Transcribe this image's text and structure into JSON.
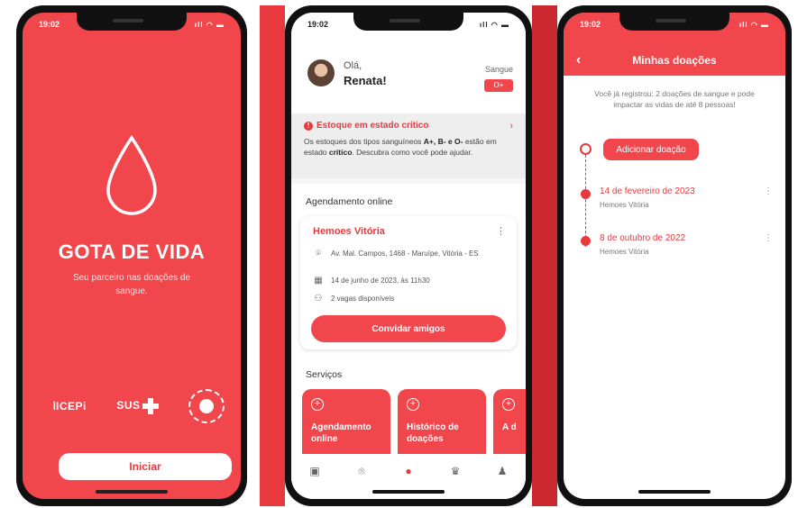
{
  "welcome": {
    "time": "19:02",
    "signal": "ıll ◠ ▬",
    "app_name": "GOTA DE VIDA",
    "tagline": "Seu parceiro nas doações de sangue.",
    "partner_icepi": "ICEPi",
    "partner_sus": "SUS",
    "start_label": "Iniciar"
  },
  "home": {
    "time": "19:02",
    "signal": "ıll ◠ ▬",
    "greeting": "Olá,",
    "user_name": "Renata!",
    "blood_label": "Sangue",
    "blood_type": "O+",
    "alert_title": "Estoque em estado crítico",
    "alert_text_1": "Os estoques dos tipos sanguíneos ",
    "alert_types": "A+, B- e O-",
    "alert_text_2": " estão em estado ",
    "alert_word": "crítico",
    "alert_text_3": ". Descubra como você pode ajudar.",
    "schedule_title": "Agendamento online",
    "center_name": "Hemoes Vitória",
    "address": "Av. Mal. Campos, 1468 - Maruípe, Vitória - ES",
    "datetime": "14 de junho de 2023, às 11h30",
    "vacancies": "2 vagas disponíveis",
    "invite_label": "Convidar amigos",
    "services_title": "Serviços",
    "services": [
      {
        "label": "Agendamento online"
      },
      {
        "label": "Histórico de doações"
      },
      {
        "label": "A d"
      }
    ]
  },
  "donations": {
    "time": "19:02",
    "signal": "ıll ◠ ▬",
    "title": "Minhas doações",
    "summary": "Você já registrou: 2 doações de sangue e pode impactar as vidas de até 8 pessoas!",
    "add_label": "Adicionar doação",
    "items": [
      {
        "date": "14 de fevereiro de 2023",
        "place": "Hemoes Vitória"
      },
      {
        "date": "8 de outubro de 2022",
        "place": "Hemoes Vitória"
      }
    ]
  },
  "colors": {
    "brand_red": "#f0464c",
    "dark_red": "#c9282e"
  }
}
